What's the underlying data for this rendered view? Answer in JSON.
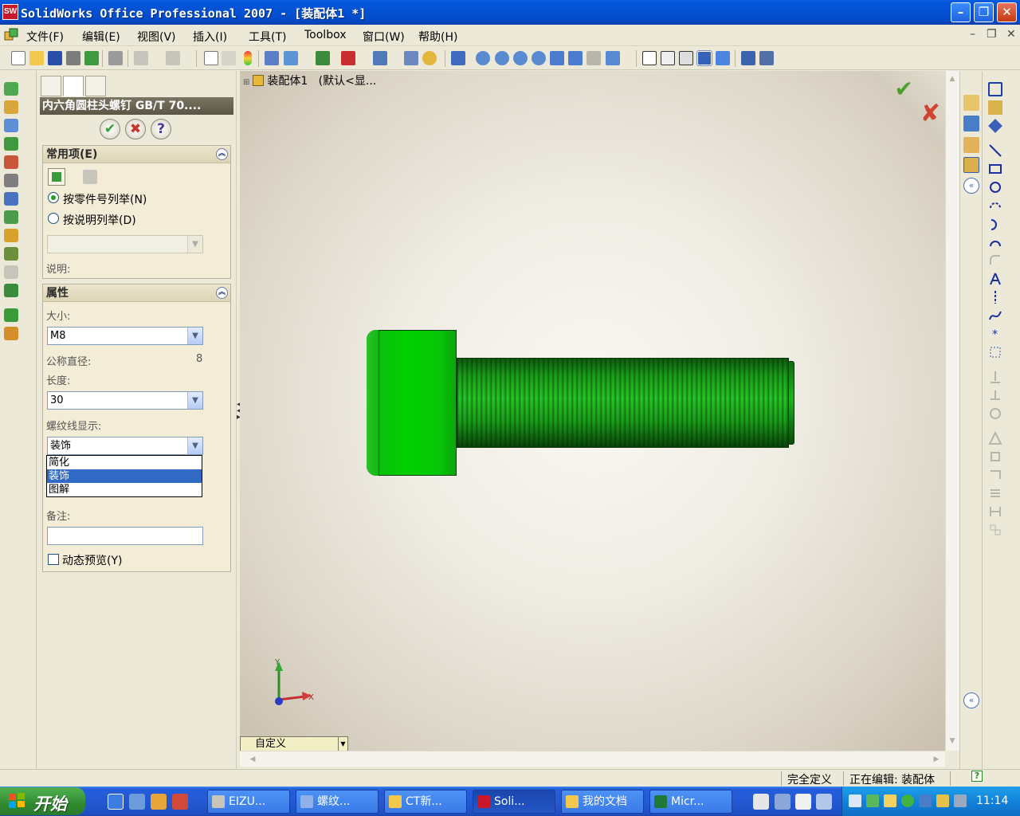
{
  "window": {
    "title": "SolidWorks Office Professional 2007 - [装配体1 *]",
    "logo_text": "SW"
  },
  "menu": {
    "items": [
      "文件(F)",
      "编辑(E)",
      "视图(V)",
      "插入(I)",
      "工具(T)",
      "Toolbox",
      "窗口(W)",
      "帮助(H)"
    ]
  },
  "property_manager": {
    "title": "内六角圆柱头螺钉 GB/T 70....",
    "group_common": {
      "header": "常用项(E)",
      "radio_by_part_number": "按零件号列举(N)",
      "radio_by_description": "按说明列举(D)",
      "selected_radio": "by_part_number",
      "description_label": "说明:"
    },
    "group_properties": {
      "header": "属性",
      "size_label": "大小:",
      "size_value": "M8",
      "nominal_diameter_label": "公称直径:",
      "nominal_diameter_value": "8",
      "length_label": "长度:",
      "length_value": "30",
      "thread_display_label": "螺纹线显示:",
      "thread_display_value": "装饰",
      "thread_display_options": [
        "简化",
        "装饰",
        "图解"
      ],
      "thread_display_selected_index": 1,
      "comment_label": "备注:",
      "comment_value": "",
      "dynamic_preview_label": "动态预览(Y)",
      "dynamic_preview_checked": false
    }
  },
  "viewport": {
    "tree_root": "装配体1",
    "tree_config": "(默认<显...",
    "config_combo": "自定义",
    "triad_x": "X",
    "triad_y": "Y"
  },
  "statusbar": {
    "state": "完全定义",
    "editing": "正在编辑: 装配体"
  },
  "taskbar": {
    "start_label": "开始",
    "tasks": [
      "EIZU...",
      "螺纹...",
      "CT新...",
      "Soli...",
      "我的文档",
      "Micr..."
    ],
    "active_task_index": 3,
    "clock": "11:14"
  },
  "colors": {
    "bolt_green": "#00cc00",
    "titlebar_blue": "#0453d8",
    "accept_green": "#4ca12c",
    "cancel_red": "#d14433"
  }
}
